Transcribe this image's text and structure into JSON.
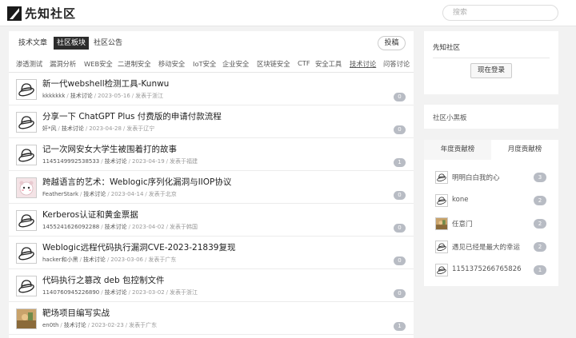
{
  "header": {
    "site_name": "先知社区",
    "search_placeholder": "搜索"
  },
  "tabs": [
    {
      "label": "技术文章",
      "active": false
    },
    {
      "label": "社区板块",
      "active": true
    },
    {
      "label": "社区公告",
      "active": false
    }
  ],
  "post_button": "投稿",
  "categories": [
    "渗透测试",
    "漏洞分析",
    "WEB安全",
    "二进制安全",
    "移动安全",
    "IoT安全",
    "企业安全",
    "区块链安全",
    "CTF",
    "安全工具",
    "技术讨论",
    "问答讨论"
  ],
  "active_category": "技术讨论",
  "posts": [
    {
      "title": "新一代webshell检测工具-Kunwu",
      "author": "kkkkkkk",
      "category": "技术讨论",
      "date": "2023-05-16",
      "location": "发表于浙江",
      "count": "0",
      "avatar": "default"
    },
    {
      "title": "分享一下 ChatGPT Plus 付费版的申请付款流程",
      "author": "奸*风",
      "category": "技术讨论",
      "date": "2023-04-28",
      "location": "发表于辽宁",
      "count": "0",
      "avatar": "default"
    },
    {
      "title": "记一次网安女大学生被围着打的故事",
      "author": "1145149992538533",
      "category": "技术讨论",
      "date": "2023-04-19",
      "location": "发表于福建",
      "count": "1",
      "avatar": "default"
    },
    {
      "title": "跨越语言的艺术：Weblogic序列化漏洞与IIOP协议",
      "author": "FeatherStark",
      "category": "技术讨论",
      "date": "2023-04-14",
      "location": "发表于北京",
      "count": "0",
      "avatar": "cute"
    },
    {
      "title": "Kerberos认证和黄金票据",
      "author": "1455241626092288",
      "category": "技术讨论",
      "date": "2023-04-02",
      "location": "发表于韩国",
      "count": "0",
      "avatar": "default"
    },
    {
      "title": "Weblogic远程代码执行漏洞CVE-2023-21839复现",
      "author": "hacker和小黑",
      "category": "技术讨论",
      "date": "2023-03-06",
      "location": "发表于广东",
      "count": "0",
      "avatar": "default"
    },
    {
      "title": "代码执行之篡改 deb 包控制文件",
      "author": "1140760945226890",
      "category": "技术讨论",
      "date": "2023-03-02",
      "location": "发表于浙江",
      "count": "0",
      "avatar": "default"
    },
    {
      "title": "靶场项目编写实战",
      "author": "en0th",
      "category": "技术讨论",
      "date": "2023-02-23",
      "location": "发表于广东",
      "count": "1",
      "avatar": "photo"
    }
  ],
  "sidebar": {
    "login_card_title": "先知社区",
    "login_button": "现在登录",
    "blackboard_title": "社区小黑板",
    "rank_tabs": [
      "年度贡献榜",
      "月度贡献榜"
    ],
    "rank_active": 1,
    "ranking": [
      {
        "name": "明明白白我的心",
        "count": "3",
        "avatar": "default"
      },
      {
        "name": "kone",
        "count": "2",
        "avatar": "default"
      },
      {
        "name": "任意门",
        "count": "2",
        "avatar": "photo"
      },
      {
        "name": "遇见已经是最大的幸运",
        "count": "2",
        "avatar": "default"
      },
      {
        "name": "1151375266765826",
        "count": "1",
        "avatar": "default"
      }
    ]
  },
  "colors": {
    "active_tab_bg": "#2c2c2c",
    "badge_bg": "#b8bcc4",
    "page_bg": "#f2f2f2"
  },
  "icons": {
    "logo": "xianzhi-logo-icon",
    "default_avatar": "hat-avatar-icon"
  }
}
